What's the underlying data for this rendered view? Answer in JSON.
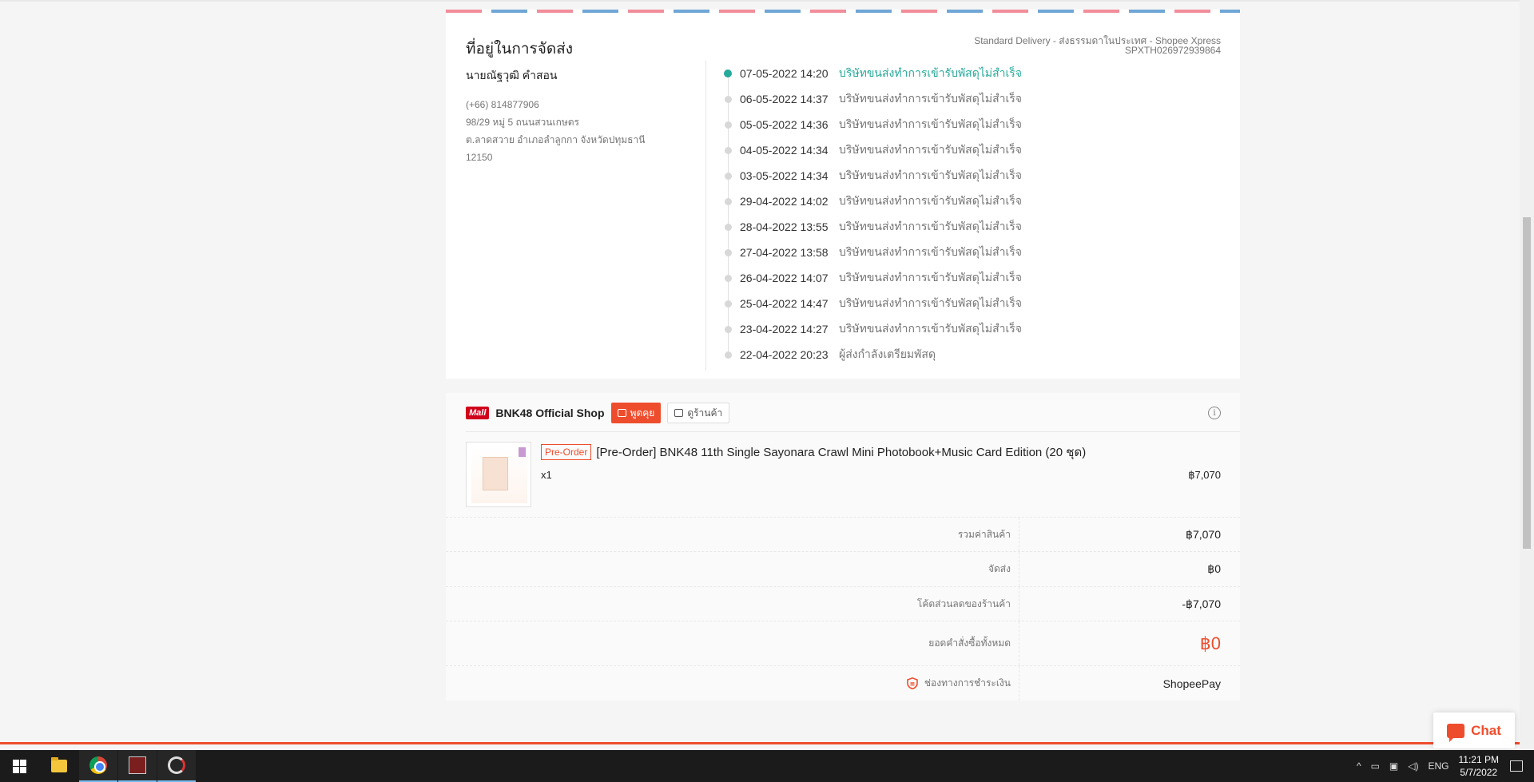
{
  "shipping": {
    "title": "ที่อยู่ในการจัดส่ง",
    "service": "Standard Delivery - ส่งธรรมดาในประเทศ - Shopee Xpress",
    "tracking_no": "SPXTH026972939864",
    "address": {
      "name": "นายณัฐวุฒิ คำสอน",
      "phone": "(+66) 814877906",
      "line1": "98/29 หมู่ 5 ถนนสวนเกษตร",
      "line2": "ต.ลาดสวาย อำเภอลำลูกกา จังหวัดปทุมธานี 12150"
    },
    "timeline": [
      {
        "time": "07-05-2022 14:20",
        "status": "บริษัทขนส่งทำการเข้ารับพัสดุไม่สำเร็จ"
      },
      {
        "time": "06-05-2022 14:37",
        "status": "บริษัทขนส่งทำการเข้ารับพัสดุไม่สำเร็จ"
      },
      {
        "time": "05-05-2022 14:36",
        "status": "บริษัทขนส่งทำการเข้ารับพัสดุไม่สำเร็จ"
      },
      {
        "time": "04-05-2022 14:34",
        "status": "บริษัทขนส่งทำการเข้ารับพัสดุไม่สำเร็จ"
      },
      {
        "time": "03-05-2022 14:34",
        "status": "บริษัทขนส่งทำการเข้ารับพัสดุไม่สำเร็จ"
      },
      {
        "time": "29-04-2022 14:02",
        "status": "บริษัทขนส่งทำการเข้ารับพัสดุไม่สำเร็จ"
      },
      {
        "time": "28-04-2022 13:55",
        "status": "บริษัทขนส่งทำการเข้ารับพัสดุไม่สำเร็จ"
      },
      {
        "time": "27-04-2022 13:58",
        "status": "บริษัทขนส่งทำการเข้ารับพัสดุไม่สำเร็จ"
      },
      {
        "time": "26-04-2022 14:07",
        "status": "บริษัทขนส่งทำการเข้ารับพัสดุไม่สำเร็จ"
      },
      {
        "time": "25-04-2022 14:47",
        "status": "บริษัทขนส่งทำการเข้ารับพัสดุไม่สำเร็จ"
      },
      {
        "time": "23-04-2022 14:27",
        "status": "บริษัทขนส่งทำการเข้ารับพัสดุไม่สำเร็จ"
      },
      {
        "time": "22-04-2022 20:23",
        "status": "ผู้ส่งกำลังเตรียมพัสดุ"
      }
    ]
  },
  "shop": {
    "mall_badge": "Mall",
    "name": "BNK48 Official Shop",
    "chat_label": "พูดคุย",
    "view_shop_label": "ดูร้านค้า",
    "info_icon": "i"
  },
  "product": {
    "tag": "Pre-Order",
    "title": "[Pre-Order] BNK48 11th Single Sayonara Crawl Mini Photobook+Music Card Edition (20 ชุด)",
    "qty": "x1",
    "price": "฿7,070"
  },
  "summary": {
    "rows": [
      {
        "label": "รวมค่าสินค้า",
        "value": "฿7,070"
      },
      {
        "label": "จัดส่ง",
        "value": "฿0"
      },
      {
        "label": "โค้ดส่วนลดของร้านค้า",
        "value": "-฿7,070"
      },
      {
        "label": "ยอดคำสั่งซื้อทั้งหมด",
        "value": "฿0"
      },
      {
        "label": "ช่องทางการชำระเงิน",
        "value": "ShopeePay"
      }
    ]
  },
  "chat_float": {
    "label": "Chat"
  },
  "taskbar": {
    "language": "ENG",
    "time": "11:21 PM",
    "date": "5/7/2022"
  },
  "colors": {
    "accent": "#ee4d2d",
    "timeline_active": "#26aa99",
    "mall_red": "#d0011b"
  }
}
